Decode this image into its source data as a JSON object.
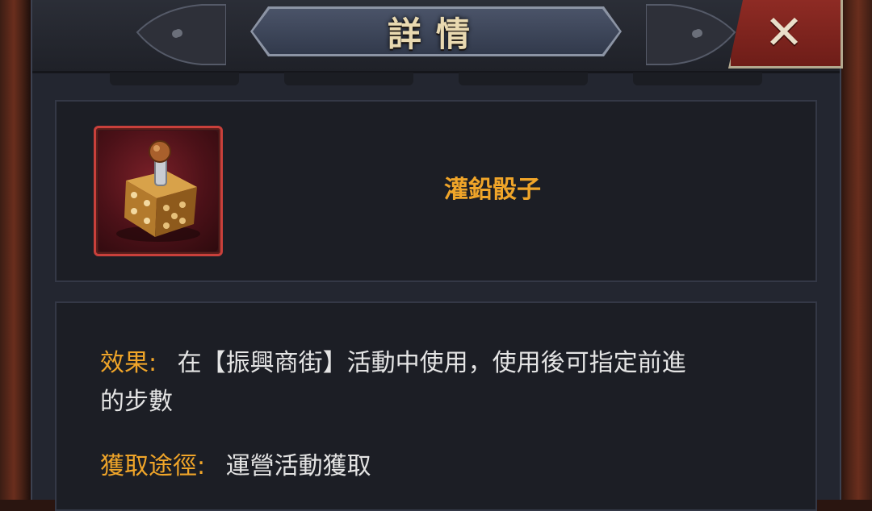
{
  "window": {
    "title": "詳情",
    "close_icon": "close-x-icon"
  },
  "item": {
    "name": "灌鉛骰子",
    "icon": "loaded-dice-icon",
    "rarity_color": "#c9403b"
  },
  "details": {
    "effect_label": "效果:",
    "effect_text_line1": "在【振興商街】活動中使用，使用後可指定前進",
    "effect_text_line2": "的步數",
    "source_label": "獲取途徑:",
    "source_text": "運營活動獲取"
  },
  "colors": {
    "accent": "#f0a529",
    "panel": "#232630",
    "close_button": "#8e2b24"
  }
}
